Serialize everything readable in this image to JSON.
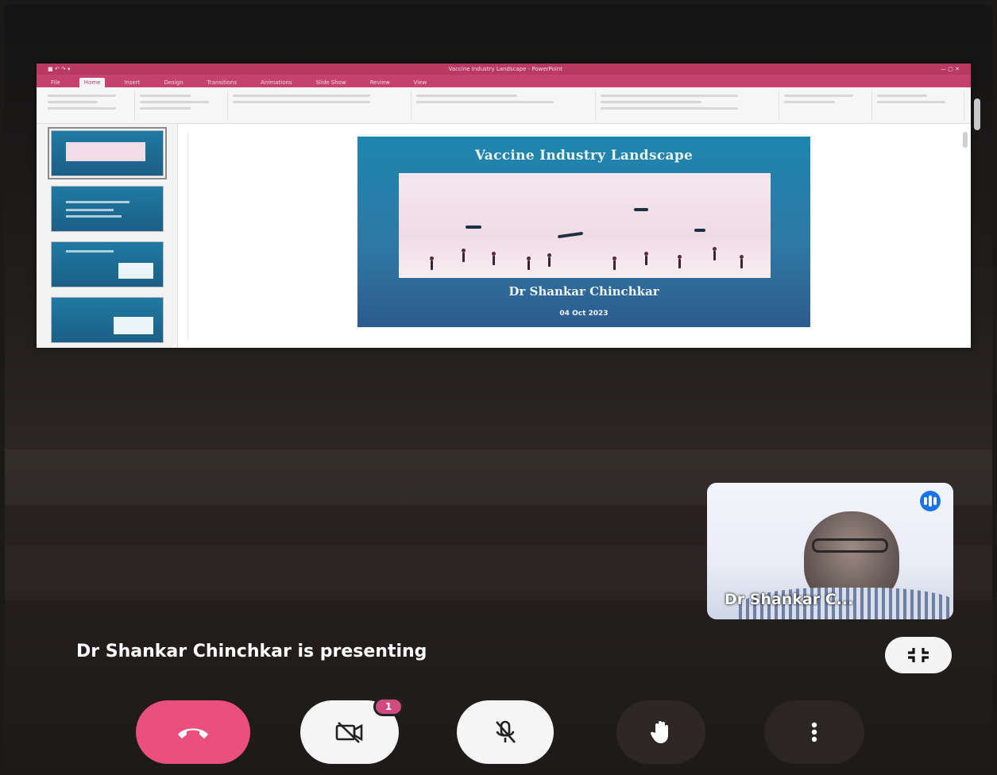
{
  "powerpoint": {
    "window_title": "Vaccine Industry Landscape - PowerPoint",
    "ribbon_tabs": [
      "File",
      "Home",
      "Insert",
      "Design",
      "Transitions",
      "Animations",
      "Slide Show",
      "Review",
      "View"
    ]
  },
  "slide": {
    "title": "Vaccine Industry Landscape",
    "presenter": "Dr Shankar Chinchkar",
    "date": "04 Oct 2023"
  },
  "participant": {
    "name": "Dr Shankar C..."
  },
  "meeting": {
    "presenting_text": "Dr Shankar Chinchkar is presenting",
    "notification_count": "1"
  },
  "controls": {
    "end_call_icon": "phone-hangup-icon",
    "camera_icon": "camera-off-icon",
    "mic_icon": "mic-off-icon",
    "hand_icon": "raise-hand-icon",
    "more_icon": "more-vert-icon",
    "fullscreen_icon": "exit-fullscreen-icon"
  },
  "colors": {
    "end_call": "#ea4f7d",
    "powerpoint_brand": "#c5426f",
    "slide_background": "#1d86ae",
    "badge": "#d24b7f",
    "speaking_indicator": "#1a73e8"
  }
}
